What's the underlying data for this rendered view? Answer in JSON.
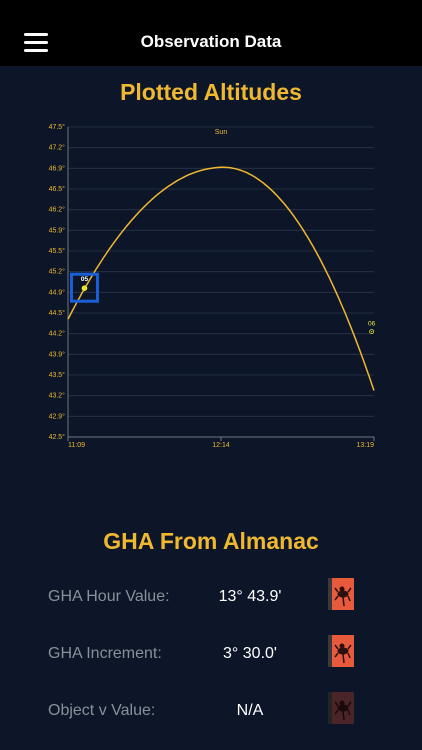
{
  "header": {
    "title": "Observation Data",
    "menu_icon": "hamburger-menu-icon"
  },
  "chart_section": {
    "title": "Plotted Altitudes"
  },
  "chart_data": {
    "type": "line",
    "series": [
      {
        "name": "Sun",
        "values": []
      }
    ],
    "x_tick_labels": [
      "11:09",
      "12:14",
      "13:19"
    ],
    "x_ticks_minutes": [
      669,
      734,
      799
    ],
    "y_tick_labels": [
      "42.5°",
      "42.9°",
      "43.2°",
      "43.5°",
      "43.9°",
      "44.2°",
      "44.5°",
      "44.9°",
      "45.2°",
      "45.5°",
      "45.9°",
      "46.2°",
      "46.5°",
      "46.9°",
      "47.2°",
      "47.5°"
    ],
    "ylim": [
      42.5,
      47.5
    ],
    "curve": {
      "peak_time_minutes": 735,
      "peak_altitude": 46.85,
      "start_altitude": 44.4,
      "end_altitude": 43.25
    },
    "points": [
      {
        "label": "05",
        "time_minutes": 676,
        "altitude": 44.9,
        "selected": true
      },
      {
        "label": "06",
        "time_minutes": 798,
        "altitude": 44.2,
        "selected": false
      }
    ],
    "colors": {
      "curve": "#f0b830",
      "point": "#e8e830",
      "selection": "#1a5fd8",
      "grid": "#2a3548",
      "axis": "#8a8f99",
      "tick_text": "#f0b830"
    }
  },
  "almanac": {
    "title": "GHA From Almanac",
    "rows": [
      {
        "label": "GHA Hour Value:",
        "value": "13° 43.9'",
        "button_icon": "lizard-icon",
        "enabled": true
      },
      {
        "label": "GHA Increment:",
        "value": "3° 30.0'",
        "button_icon": "lizard-icon",
        "enabled": true
      },
      {
        "label": "Object v Value:",
        "value": "N/A",
        "button_icon": "lizard-icon",
        "enabled": false
      }
    ]
  },
  "colors": {
    "background": "#0c1628",
    "header": "#000000",
    "accent": "#f0b830",
    "button": "#e85a3c",
    "button_disabled": "#5a2a2a"
  }
}
